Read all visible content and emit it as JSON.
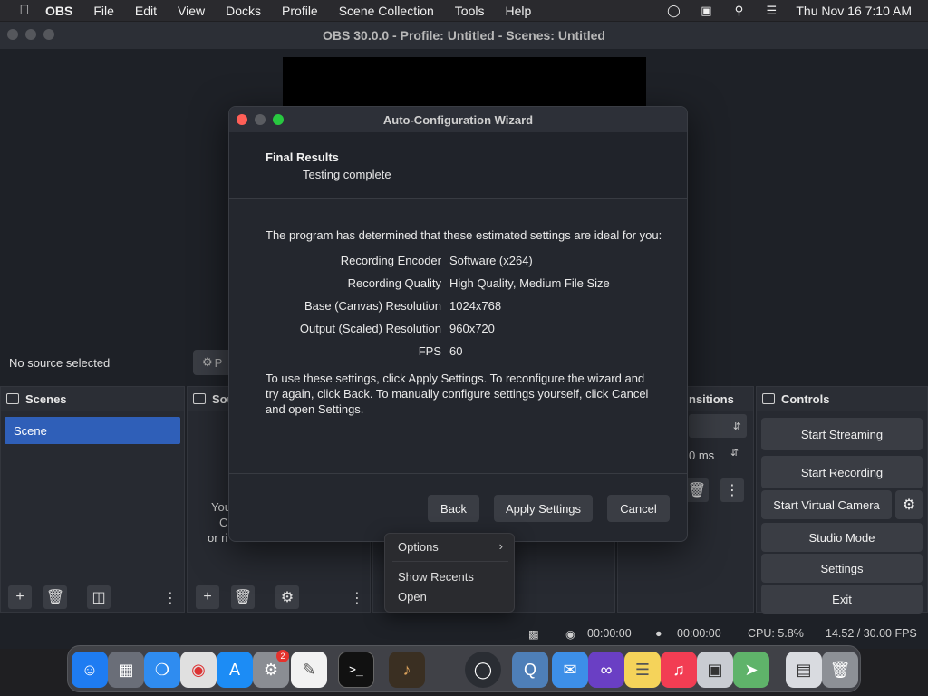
{
  "menubar": {
    "app_name": "OBS",
    "items": [
      "File",
      "Edit",
      "View",
      "Docks",
      "Profile",
      "Scene Collection",
      "Tools",
      "Help"
    ],
    "clock": "Thu Nov 16  7:10 AM"
  },
  "window": {
    "title": "OBS 30.0.0 - Profile: Untitled - Scenes: Untitled"
  },
  "source_bar": {
    "status": "No source selected",
    "properties_label": "P"
  },
  "scenes": {
    "title": "Scenes",
    "items": [
      "Scene"
    ]
  },
  "sources": {
    "title": "Sou",
    "empty_lines": [
      "You",
      "Cl",
      "or ri"
    ]
  },
  "transitions": {
    "title": "nsitions",
    "duration": "0 ms"
  },
  "controls": {
    "title": "Controls",
    "start_streaming": "Start Streaming",
    "start_recording": "Start Recording",
    "start_virtual_camera": "Start Virtual Camera",
    "studio_mode": "Studio Mode",
    "settings": "Settings",
    "exit": "Exit"
  },
  "statusbar": {
    "stream_time": "00:00:00",
    "record_time": "00:00:00",
    "cpu": "CPU: 5.8%",
    "fps": "14.52 / 30.00 FPS"
  },
  "dialog": {
    "title": "Auto-Configuration Wizard",
    "heading": "Final Results",
    "subheading": "Testing complete",
    "intro": "The program has determined that these estimated settings are ideal for you:",
    "results": [
      {
        "label": "Recording Encoder",
        "value": "Software (x264)"
      },
      {
        "label": "Recording Quality",
        "value": "High Quality, Medium File Size"
      },
      {
        "label": "Base (Canvas) Resolution",
        "value": "1024x768"
      },
      {
        "label": "Output (Scaled) Resolution",
        "value": "960x720"
      },
      {
        "label": "FPS",
        "value": "60"
      }
    ],
    "outro": "To use these settings, click Apply Settings. To reconfigure the wizard and try again, click Back. To manually configure settings yourself, click Cancel and open Settings.",
    "back_label": "Back",
    "apply_label": "Apply Settings",
    "cancel_label": "Cancel"
  },
  "context_menu": {
    "options": "Options",
    "show_recents": "Show Recents",
    "open": "Open"
  },
  "dock": {
    "badge_count": "2",
    "apps": [
      "finder-icon",
      "launchpad-icon",
      "safari-icon",
      "chrome-icon",
      "app-store-icon",
      "system-settings-icon",
      "textedit-icon",
      "terminal-icon",
      "garageband-icon",
      "obs-icon",
      "quicktime-icon",
      "mail-icon",
      "visual-studio-icon",
      "notes-icon",
      "music-icon",
      "preview-icon",
      "maps-icon",
      "documents-icon",
      "trash-icon"
    ]
  }
}
